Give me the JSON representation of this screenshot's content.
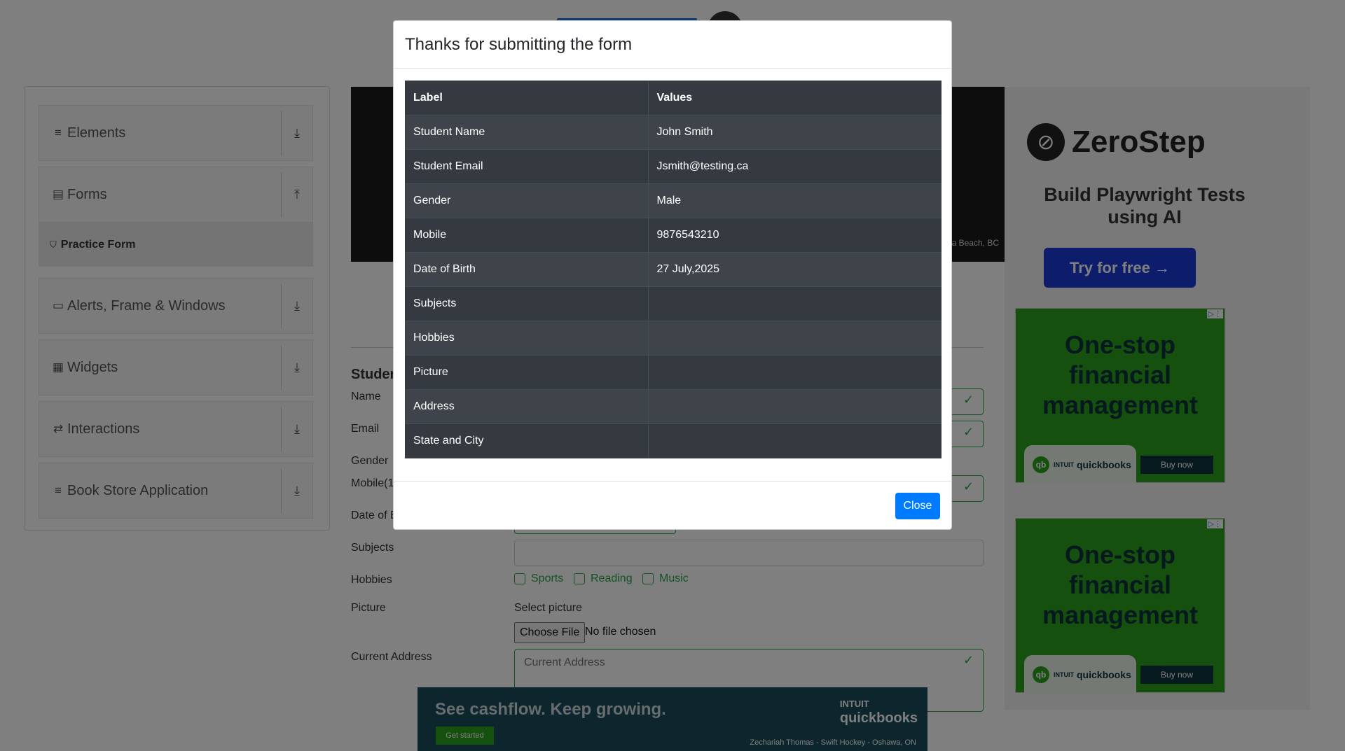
{
  "sidebar": {
    "groups": [
      {
        "label": "Elements",
        "icon": "list-icon",
        "glyph": "≡",
        "arrow": "⤓"
      },
      {
        "label": "Forms",
        "icon": "document-icon",
        "glyph": "▤",
        "arrow": "⤒"
      },
      {
        "label": "Alerts, Frame & Windows",
        "icon": "window-icon",
        "glyph": "▭",
        "arrow": "⤓"
      },
      {
        "label": "Widgets",
        "icon": "widgets-icon",
        "glyph": "▦",
        "arrow": "⤓"
      },
      {
        "label": "Interactions",
        "icon": "interaction-icon",
        "glyph": "⇄",
        "arrow": "⤓"
      },
      {
        "label": "Book Store Application",
        "icon": "book-icon",
        "glyph": "≡",
        "arrow": "⤓"
      }
    ],
    "active_item": {
      "label": "Practice Form",
      "icon_glyph": "⛉"
    }
  },
  "banner": {
    "location_caption": "a Beach, BC"
  },
  "form": {
    "heading": "Studer",
    "labels": {
      "name": "Name",
      "email": "Email",
      "gender": "Gender",
      "mobile": "Mobile(1",
      "dob": "Date of E",
      "subjects": "Subjects",
      "hobbies": "Hobbies",
      "picture": "Picture",
      "address": "Current Address"
    },
    "hobbies": [
      "Sports",
      "Reading",
      "Music"
    ],
    "select_picture": "Select picture",
    "choose_file": "Choose File",
    "no_file": "No file chosen",
    "address_placeholder": "Current Address",
    "check_glyph": "✓"
  },
  "modal": {
    "title": "Thanks for submitting the form",
    "columns": [
      "Label",
      "Values"
    ],
    "rows": [
      [
        "Student Name",
        "John Smith"
      ],
      [
        "Student Email",
        "Jsmith@testing.ca"
      ],
      [
        "Gender",
        "Male"
      ],
      [
        "Mobile",
        "9876543210"
      ],
      [
        "Date of Birth",
        "27 July,2025"
      ],
      [
        "Subjects",
        ""
      ],
      [
        "Hobbies",
        ""
      ],
      [
        "Picture",
        ""
      ],
      [
        "Address",
        ""
      ],
      [
        "State and City",
        ""
      ]
    ],
    "close_label": "Close"
  },
  "ads": {
    "zerostep": {
      "name": "ZeroStep",
      "tagline": "Build Playwright Tests using AI",
      "cta": "Try for free →"
    },
    "quickbooks": {
      "headline": "One-stop financial management",
      "brand": "quickbooks",
      "brand_prefix": "INTUIT",
      "cta": "Buy now",
      "logo_glyph": "qb"
    },
    "bottom": {
      "headline": "See cashflow. Keep growing.",
      "cta": "Get started",
      "brand": "quickbooks",
      "brand_prefix": "INTUIT",
      "caption": "Zechariah Thomas - Swift Hockey - Oshawa, ON"
    }
  },
  "colors": {
    "accent": "#007bff",
    "valid": "#28a745",
    "table_bg": "#343a40"
  }
}
